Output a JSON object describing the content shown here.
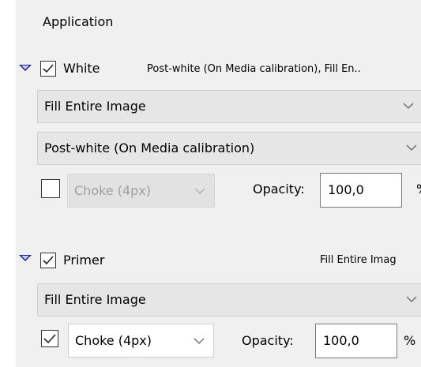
{
  "application": {
    "title": "Application"
  },
  "white": {
    "checked": true,
    "label": "White",
    "summary": "Post-white (On Media calibration), Fill En..",
    "fill_dropdown": "Fill Entire Image",
    "calibration_dropdown": "Post-white (On Media calibration)",
    "choke_checked": false,
    "choke_dropdown": "Choke (4px)",
    "choke_enabled": false,
    "opacity_label": "Opacity:",
    "opacity_value": "100,0",
    "opacity_unit": "%"
  },
  "primer": {
    "checked": true,
    "label": "Primer",
    "summary": "Fill Entire Imag",
    "fill_dropdown": "Fill Entire Image",
    "choke_checked": true,
    "choke_dropdown": "Choke (4px)",
    "choke_enabled": true,
    "opacity_label": "Opacity:",
    "opacity_value": "100,0",
    "opacity_unit": "%"
  },
  "icons": {
    "disclosure": "disclosure-triangle-icon",
    "check": "checkmark-icon",
    "chevron": "chevron-down-icon"
  }
}
